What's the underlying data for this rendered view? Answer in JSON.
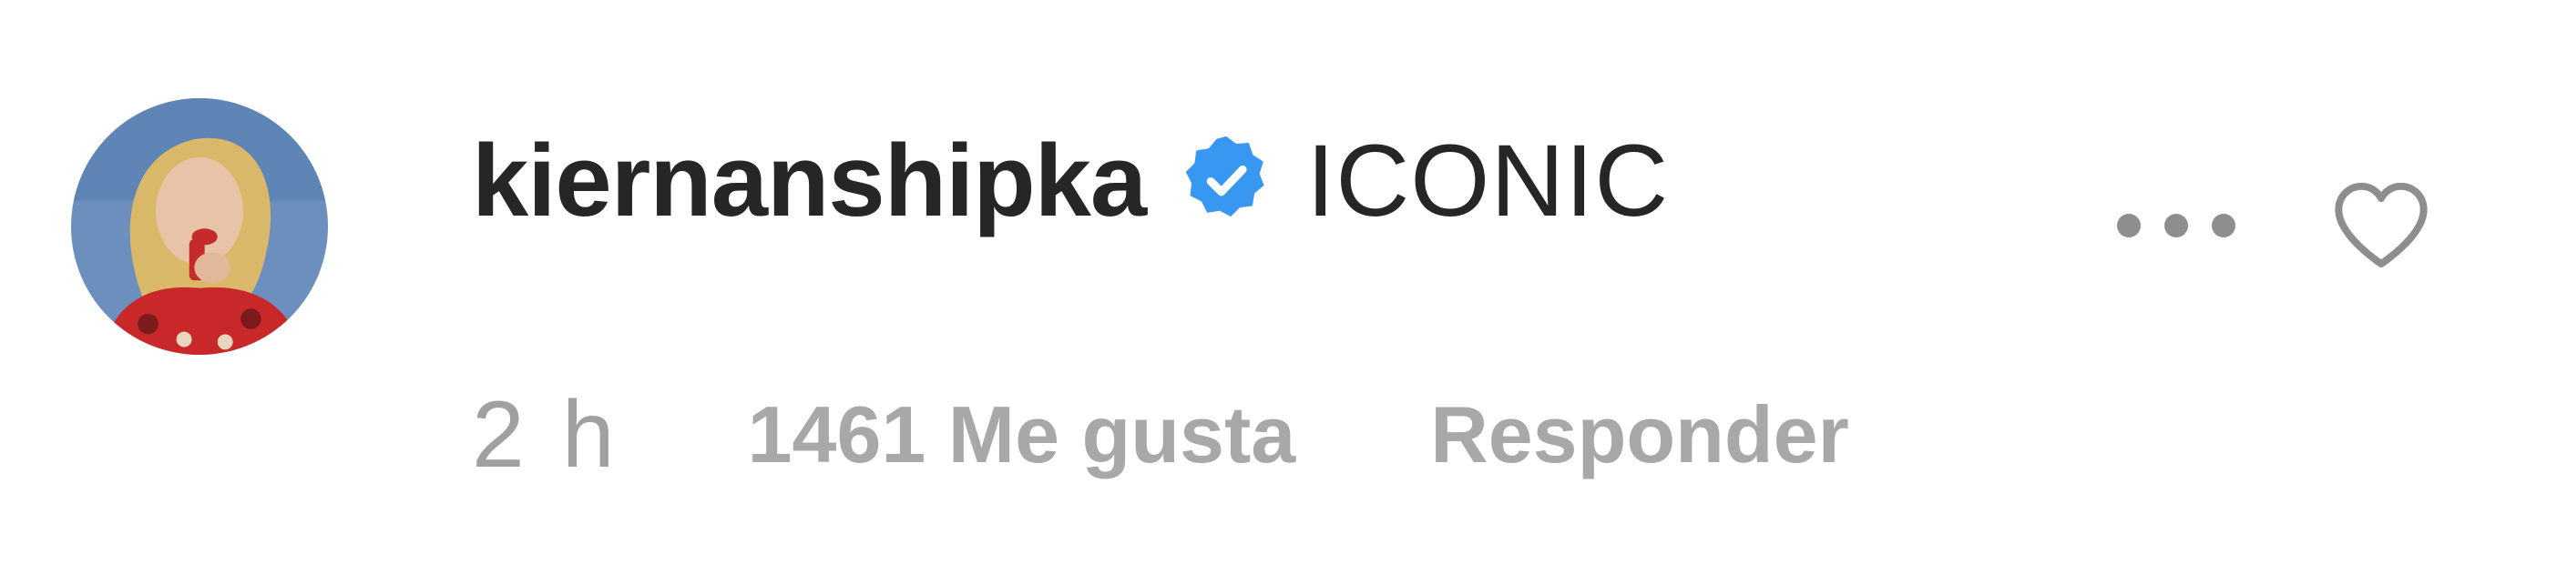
{
  "comment": {
    "username": "kiernanshipka",
    "verified": true,
    "text": "ICONIC",
    "time": "2 h",
    "likes": "1461 Me gusta",
    "reply_label": "Responder"
  },
  "icons": {
    "avatar": "profile-photo",
    "verified": "verified-badge-icon",
    "more": "more-options-icon",
    "like": "heart-outline-icon"
  },
  "colors": {
    "text_primary": "#262626",
    "text_secondary": "#a8a8a8",
    "verified_blue": "#3897f0",
    "icon_gray": "#8e8e8e"
  }
}
